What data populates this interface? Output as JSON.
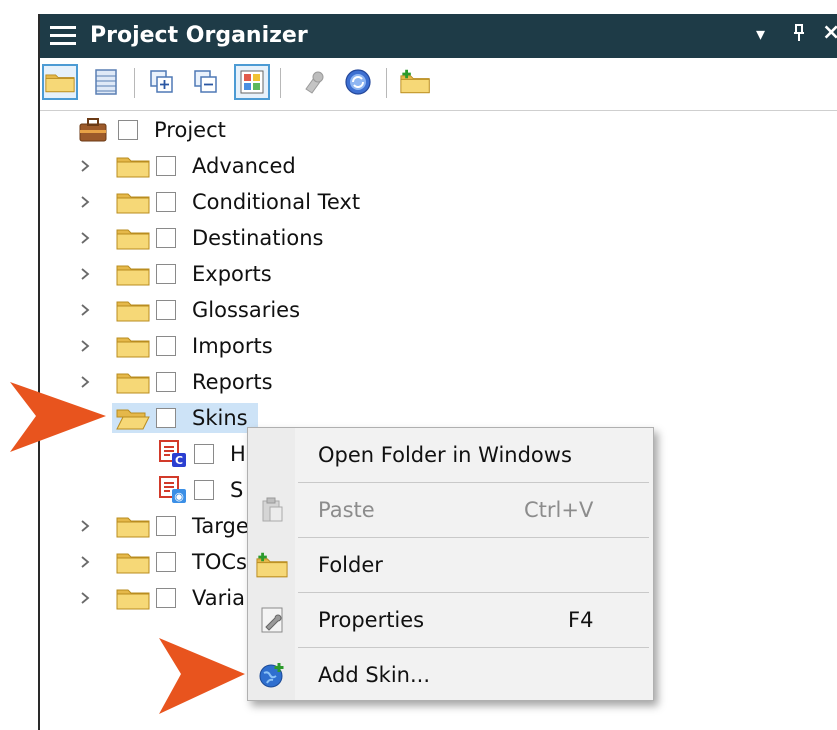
{
  "window": {
    "title": "Project Organizer",
    "controls": [
      "▾",
      "ᵖ",
      "×"
    ]
  },
  "toolbar": {
    "buttons": [
      {
        "icon": "folder-view-icon",
        "active": true
      },
      {
        "icon": "table-view-icon",
        "active": false
      },
      {
        "icon": "expand-all-icon",
        "active": false
      },
      {
        "icon": "collapse-all-icon",
        "active": false
      },
      {
        "icon": "grid-view-icon",
        "active": true
      },
      {
        "icon": "gear-icon",
        "active": false
      },
      {
        "icon": "sync-icon",
        "active": false
      },
      {
        "icon": "new-folder-icon",
        "active": false
      }
    ]
  },
  "tree": {
    "root": "Project",
    "items": [
      {
        "label": "Advanced"
      },
      {
        "label": "Conditional Text"
      },
      {
        "label": "Destinations"
      },
      {
        "label": "Exports"
      },
      {
        "label": "Glossaries"
      },
      {
        "label": "Imports"
      },
      {
        "label": "Reports"
      },
      {
        "label": "Skins",
        "selected": true,
        "expanded": true
      },
      {
        "label": "H",
        "child": true
      },
      {
        "label": "S",
        "child": true
      },
      {
        "label": "Targe"
      },
      {
        "label": "TOCs"
      },
      {
        "label": "Varia"
      }
    ]
  },
  "context_menu": {
    "items": [
      {
        "label": "Open Folder in Windows",
        "shortcut": "",
        "icon": "",
        "disabled": false
      },
      {
        "label": "Paste",
        "shortcut": "Ctrl+V",
        "icon": "clipboard-icon",
        "disabled": true
      },
      {
        "label": "Folder",
        "shortcut": "",
        "icon": "new-folder-icon",
        "disabled": false
      },
      {
        "label": "Properties",
        "shortcut": "F4",
        "icon": "properties-icon",
        "disabled": false
      },
      {
        "label": "Add Skin...",
        "shortcut": "",
        "icon": "add-skin-icon",
        "disabled": false
      }
    ]
  },
  "colors": {
    "titlebar": "#1e3b47",
    "selection": "#cde3f7",
    "arrow": "#e8541e",
    "folder": "#f2cf66"
  }
}
